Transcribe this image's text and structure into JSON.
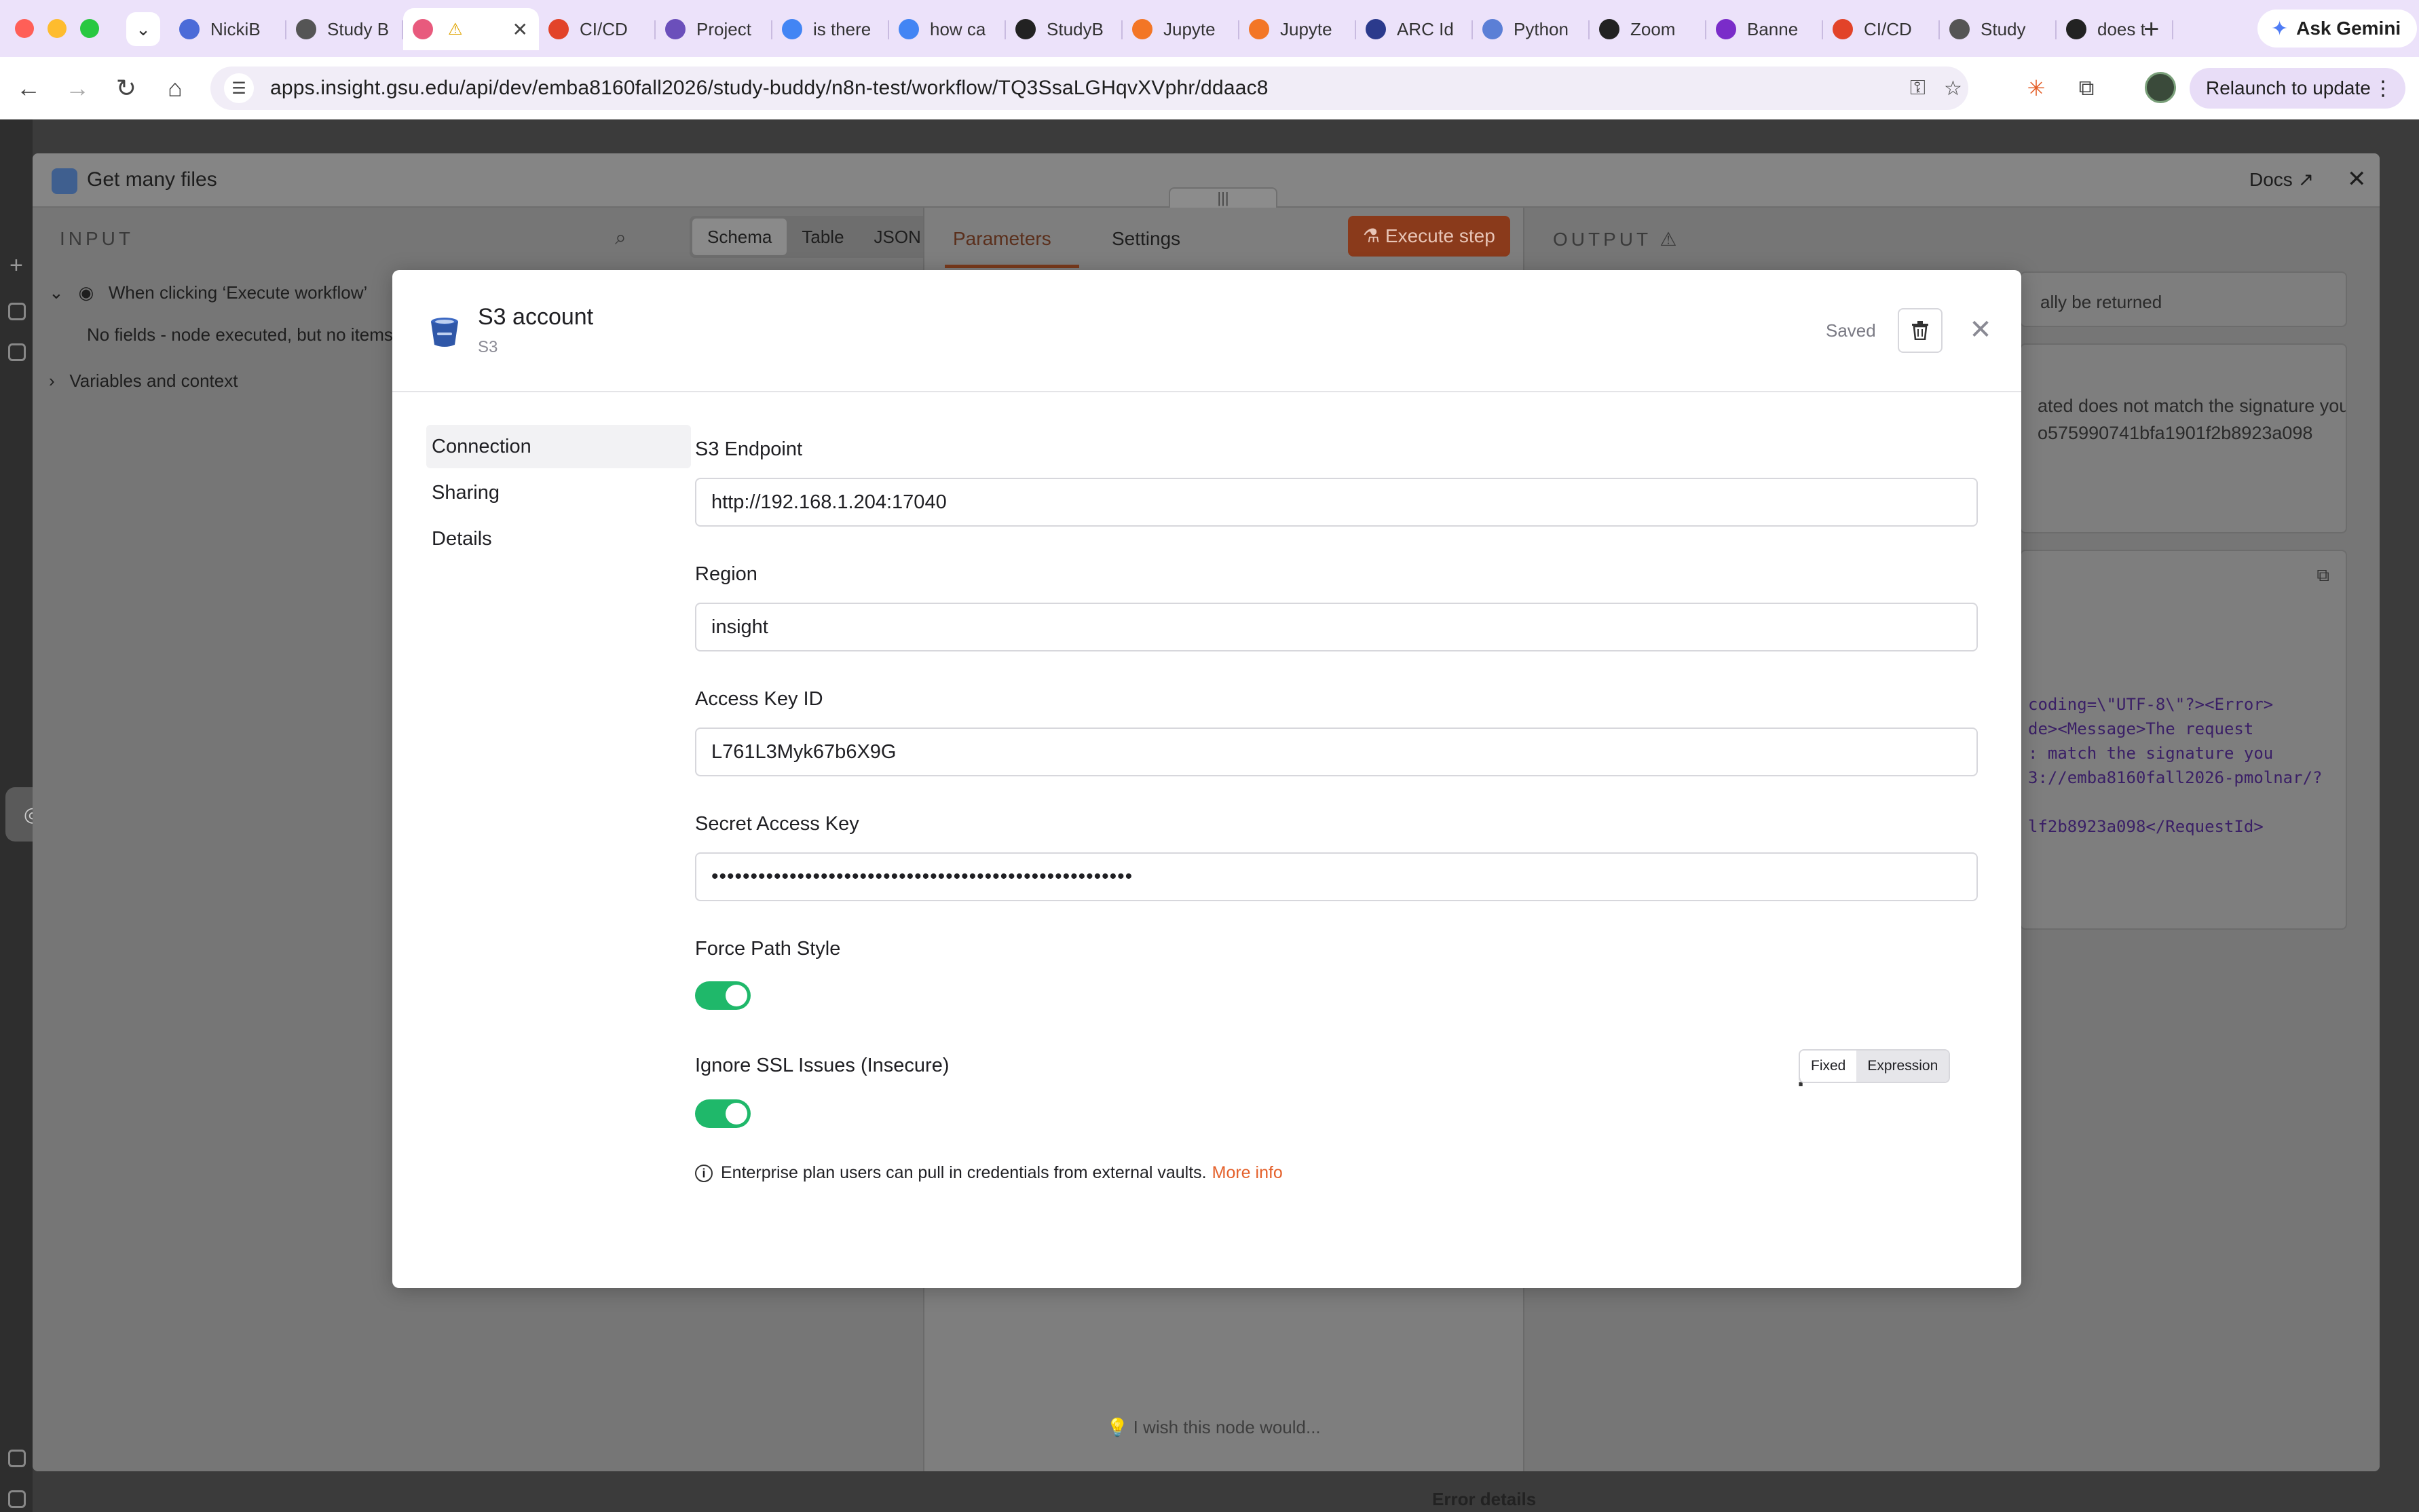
{
  "browser": {
    "tabs": [
      {
        "title": "NickiB",
        "icon_color": "#4b6bd8"
      },
      {
        "title": "Study B",
        "icon_color": "#555555"
      },
      {
        "title": "",
        "icon_color": "#e85a7d",
        "active": true
      },
      {
        "title": "CI/CD",
        "icon_color": "#e24329"
      },
      {
        "title": "Project",
        "icon_color": "#6b4fbb"
      },
      {
        "title": "is there",
        "icon_color": "#4285f4"
      },
      {
        "title": "how ca",
        "icon_color": "#4285f4"
      },
      {
        "title": "StudyB",
        "icon_color": "#222222"
      },
      {
        "title": "Jupyte",
        "icon_color": "#f37626"
      },
      {
        "title": "Jupyte",
        "icon_color": "#f37626"
      },
      {
        "title": "ARC Id",
        "icon_color": "#2b3a8c"
      },
      {
        "title": "Python",
        "icon_color": "#5b7fd6"
      },
      {
        "title": "Zoom",
        "icon_color": "#222222"
      },
      {
        "title": "Banne",
        "icon_color": "#7a2cc9"
      },
      {
        "title": "CI/CD",
        "icon_color": "#e24329"
      },
      {
        "title": "Study",
        "icon_color": "#555555"
      },
      {
        "title": "does t",
        "icon_color": "#222222"
      }
    ],
    "new_tab_icon": "+",
    "gemini_label": "Ask Gemini",
    "url": "apps.insight.gsu.edu/api/dev/emba8160fall2026/study-buddy/n8n-test/workflow/TQ3SsaLGHqvXVphr/ddaac8",
    "relaunch_label": "Relaunch to update"
  },
  "ndv": {
    "title": "Get many files",
    "docs_label": "Docs",
    "input_label": "INPUT",
    "trigger_name": "When clicking ‘Execute workflow’",
    "no_fields_text": "No fields - node executed, but no items",
    "variables_label": "Variables and context",
    "view_tabs": [
      "Schema",
      "Table",
      "JSON"
    ],
    "params_tab": "Parameters",
    "settings_tab": "Settings",
    "execute_label": "Execute step",
    "output_label": "OUTPUT",
    "output_notice": "ally be returned",
    "output_error_lines": [
      "ated does not match the signature you",
      "o575990741bfa1901f2b8923a098"
    ],
    "output_xml": "coding=\\\"UTF-8\\\"?><Error>\nde><Message>The request\n: match the signature you\n3://emba8160fall2026-pmolnar/?\n\nlf2b8923a098</RequestId>",
    "wish_text": "I wish this node would...",
    "error_details": "Error details"
  },
  "modal": {
    "title": "S3 account",
    "subtitle": "S3",
    "saved_label": "Saved",
    "nav": [
      "Connection",
      "Sharing",
      "Details"
    ],
    "fields": {
      "endpoint_label": "S3 Endpoint",
      "endpoint_value": "http://192.168.1.204:17040",
      "region_label": "Region",
      "region_value": "insight",
      "access_key_label": "Access Key ID",
      "access_key_value": "L761L3Myk67b6X9G",
      "secret_label": "Secret Access Key",
      "secret_value": "••••••••••••••••••••••••••••••••••••••••••••••••••••••",
      "force_path_label": "Force Path Style",
      "force_path_on": true,
      "ignore_ssl_label": "Ignore SSL Issues (Insecure)",
      "ignore_ssl_on": true,
      "mode_fixed": "Fixed",
      "mode_expression": "Expression"
    },
    "notice_text": "Enterprise plan users can pull in credentials from external vaults.",
    "more_info": "More info"
  },
  "colors": {
    "accent": "#e4602a",
    "toggle_on": "#1fb86a"
  }
}
